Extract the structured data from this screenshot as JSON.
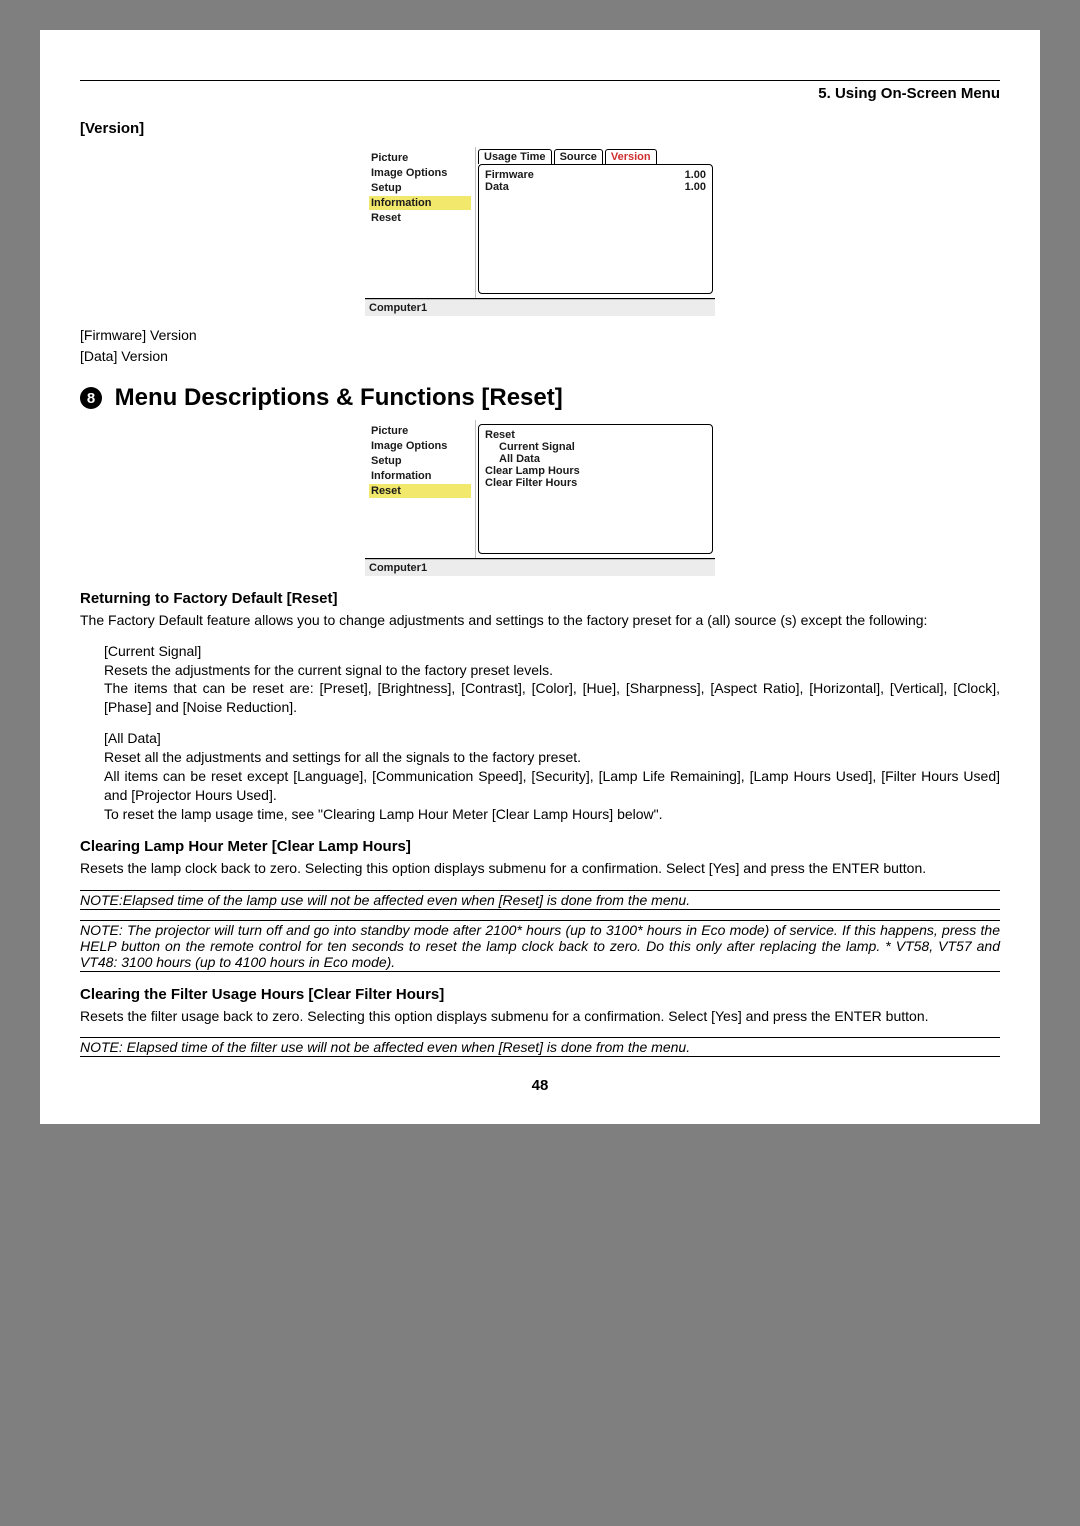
{
  "header": {
    "chapter": "5. Using On-Screen Menu"
  },
  "version": {
    "label": "[Version]",
    "menu_left": [
      "Picture",
      "Image Options",
      "Setup",
      "Information",
      "Reset"
    ],
    "menu_left_selected": 3,
    "tabs": [
      "Usage Time",
      "Source",
      "Version"
    ],
    "tab_selected": 2,
    "rows": [
      {
        "label": "Firmware",
        "value": "1.00"
      },
      {
        "label": "Data",
        "value": "1.00"
      }
    ],
    "status": "Computer1",
    "below1": "[Firmware] Version",
    "below2": "[Data] Version"
  },
  "reset_heading": {
    "num": "8",
    "title": "Menu Descriptions & Functions [Reset]"
  },
  "reset_menu": {
    "menu_left": [
      "Picture",
      "Image Options",
      "Setup",
      "Information",
      "Reset"
    ],
    "menu_left_selected": 4,
    "panel_title": "Reset",
    "panel_items_indent": [
      "Current Signal",
      "All Data"
    ],
    "panel_items": [
      "Clear Lamp Hours",
      "Clear Filter Hours"
    ],
    "status": "Computer1"
  },
  "sections": {
    "factory": {
      "title": "Returning to Factory Default [Reset]",
      "intro": "The Factory Default feature allows you to change adjustments and settings to the factory preset for a (all) source (s) except the following:",
      "cs_label": "[Current Signal]",
      "cs_line1": "Resets the adjustments for the current signal to the factory preset levels.",
      "cs_line2": "The items that can be reset are: [Preset], [Brightness], [Contrast], [Color], [Hue], [Sharpness], [Aspect Ratio], [Horizontal], [Vertical], [Clock], [Phase] and [Noise Reduction].",
      "ad_label": "[All Data]",
      "ad_line1": "Reset all the adjustments and settings for all the signals to the factory preset.",
      "ad_line2": "All items can be reset except [Language], [Communication Speed], [Security], [Lamp Life Remaining], [Lamp Hours Used], [Filter Hours Used] and [Projector Hours Used].",
      "ad_line3": "To reset the lamp usage time, see \"Clearing Lamp Hour Meter [Clear Lamp Hours] below\"."
    },
    "lamp": {
      "title": "Clearing Lamp Hour Meter [Clear Lamp Hours]",
      "body": "Resets the lamp clock back to zero. Selecting this option displays submenu for a confirmation. Select [Yes] and press the ENTER button.",
      "note1": "NOTE:Elapsed time of the lamp use will not be affected even when [Reset] is done from the menu.",
      "note2": "NOTE: The projector will turn off and go into standby mode after 2100* hours (up to 3100* hours in Eco mode) of service. If this happens, press the HELP button on the remote control for ten seconds to reset the lamp clock back to zero. Do this only after replacing the lamp. * VT58, VT57 and VT48: 3100 hours (up to 4100 hours in Eco mode)."
    },
    "filter": {
      "title": "Clearing the Filter Usage Hours [Clear Filter Hours]",
      "body": "Resets the filter usage back to zero. Selecting this option displays submenu for a confirmation. Select [Yes] and press the ENTER button.",
      "note": "NOTE: Elapsed time of the filter use will not be affected even when [Reset] is done from the menu."
    }
  },
  "page_number": "48"
}
